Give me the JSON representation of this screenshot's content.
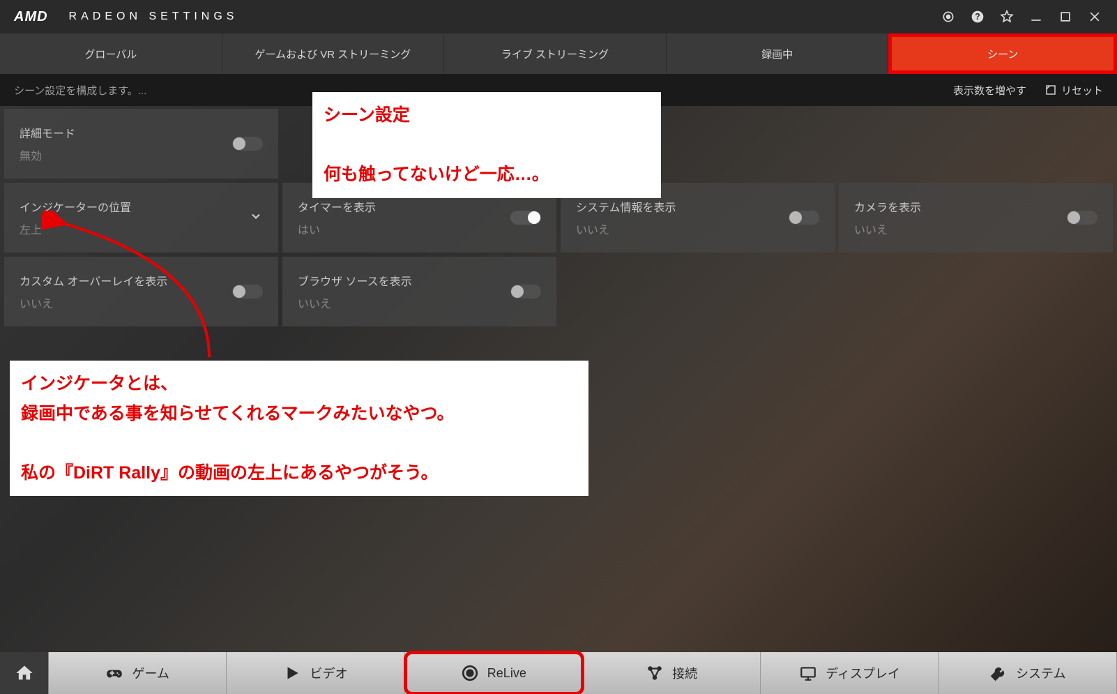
{
  "header": {
    "logo": "AMD",
    "title": "RADEON SETTINGS"
  },
  "tabs": [
    "グローバル",
    "ゲームおよび VR ストリーミング",
    "ライブ ストリーミング",
    "録画中",
    "シーン"
  ],
  "active_tab_index": 4,
  "subheader": {
    "desc": "シーン設定を構成します。...",
    "more": "表示数を増やす",
    "reset": "リセット"
  },
  "tiles": {
    "advanced_mode": {
      "label": "詳細モード",
      "value": "無効"
    },
    "indicator_pos": {
      "label": "インジケーターの位置",
      "value": "左上"
    },
    "show_timer": {
      "label": "タイマーを表示",
      "value": "はい"
    },
    "show_system": {
      "label": "システム情報を表示",
      "value": "いいえ"
    },
    "show_camera": {
      "label": "カメラを表示",
      "value": "いいえ"
    },
    "custom_overlay": {
      "label": "カスタム オーバーレイを表示",
      "value": "いいえ"
    },
    "browser_source": {
      "label": "ブラウザ ソースを表示",
      "value": "いいえ"
    }
  },
  "annotations": {
    "top": "シーン設定\n\n何も触ってないけど一応…。",
    "bottom": "インジケータとは、\n録画中である事を知らせてくれるマークみたいなやつ。\n\n私の『DiRT Rally』の動画の左上にあるやつがそう。"
  },
  "bottom_nav": {
    "games": "ゲーム",
    "video": "ビデオ",
    "relive": "ReLive",
    "connect": "接続",
    "display": "ディスプレイ",
    "system": "システム"
  }
}
